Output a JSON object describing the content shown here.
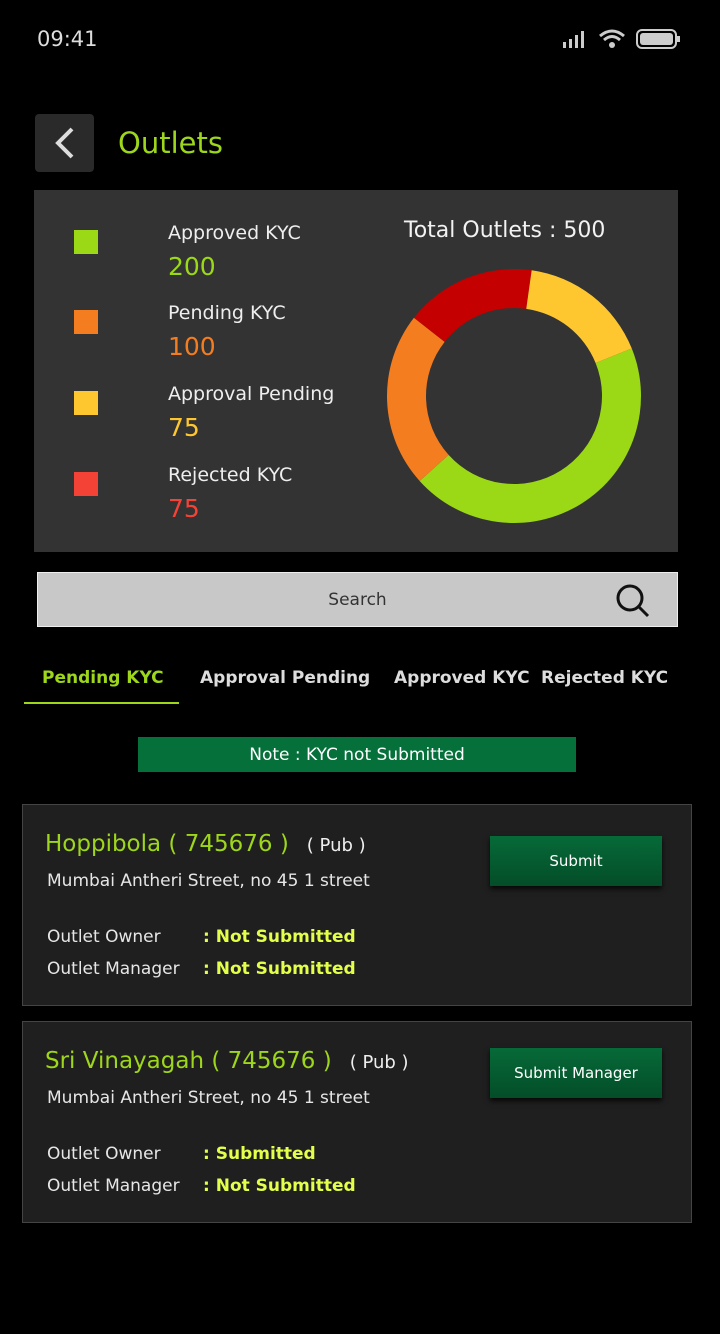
{
  "status": {
    "time": "09:41"
  },
  "header": {
    "title": "Outlets"
  },
  "summary": {
    "total_label": "Total Outlets : 500",
    "items": [
      {
        "label": "Approved KYC",
        "value": "200",
        "color": "#9bd916"
      },
      {
        "label": "Pending KYC",
        "value": "100",
        "color": "#f47d20"
      },
      {
        "label": "Approval Pending",
        "value": "75",
        "color": "#ffc72f"
      },
      {
        "label": "Rejected KYC",
        "value": "75",
        "color": "#f44336"
      }
    ]
  },
  "chart_data": {
    "type": "pie",
    "style": "donut",
    "categories": [
      "Approved KYC",
      "Pending KYC",
      "Rejected KYC",
      "Approval Pending"
    ],
    "values": [
      200,
      100,
      75,
      75
    ],
    "colors": [
      "#9bd916",
      "#f47d20",
      "#c40000",
      "#ffc72f"
    ]
  },
  "search": {
    "placeholder": "Search"
  },
  "tabs": [
    {
      "label": "Pending KYC"
    },
    {
      "label": "Approval Pending"
    },
    {
      "label": "Approved KYC"
    },
    {
      "label": "Rejected KYC"
    }
  ],
  "note": "Note : KYC not Submitted",
  "outlets": [
    {
      "name": "Hoppibola ( 745676 )",
      "type": "( Pub )",
      "address": "Mumbai Antheri Street, no 45 1 street",
      "owner_label": "Outlet Owner",
      "owner_status": ": Not Submitted",
      "manager_label": "Outlet Manager",
      "manager_status": ": Not Submitted",
      "button": "Submit"
    },
    {
      "name": "Sri Vinayagah ( 745676 )",
      "type": "( Pub )",
      "address": "Mumbai Antheri Street, no 45 1 street",
      "owner_label": "Outlet Owner",
      "owner_status": ": Submitted",
      "manager_label": "Outlet Manager",
      "manager_status": ": Not Submitted",
      "button": "Submit Manager"
    }
  ]
}
